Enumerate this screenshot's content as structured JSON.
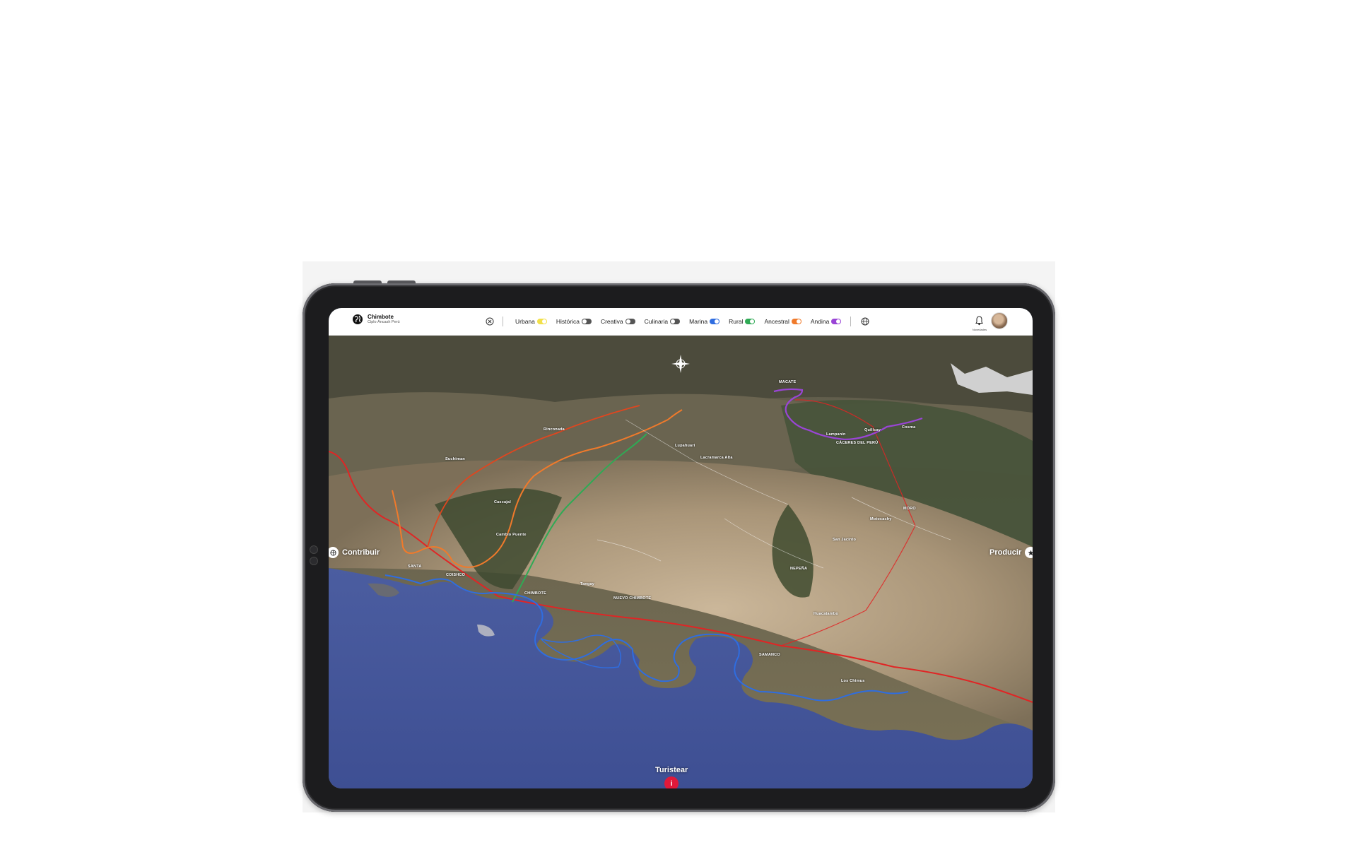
{
  "brand": {
    "name": "Chimbote",
    "subtitle": "Ciplo Áncash Perú"
  },
  "filters": [
    {
      "label": "Urbana",
      "color": "#f2e04a",
      "state": "on"
    },
    {
      "label": "Histórica",
      "color": "#555555",
      "state": "off"
    },
    {
      "label": "Creativa",
      "color": "#555555",
      "state": "off"
    },
    {
      "label": "Culinaria",
      "color": "#555555",
      "state": "off"
    },
    {
      "label": "Marina",
      "color": "#2f6de0",
      "state": "on"
    },
    {
      "label": "Rural",
      "color": "#2faa55",
      "state": "on"
    },
    {
      "label": "Ancestral",
      "color": "#f07a2b",
      "state": "on"
    },
    {
      "label": "Andina",
      "color": "#9a45d6",
      "state": "on"
    }
  ],
  "header": {
    "notifications_label": "Novedades"
  },
  "nav": {
    "left_label": "Contribuir",
    "right_label": "Producir",
    "bottom_label": "Turistear"
  },
  "places": {
    "macate": "MACATE",
    "lupahuari": "Lupahuari",
    "lacramarca": "Lacramarca Alta",
    "lampanin": "Lampanín",
    "quillcay": "Quillcay",
    "cosma": "Cosma",
    "caceres": "CÁCERES DEL PERÚ",
    "moro": "MORO",
    "motocachy": "Motocachy",
    "san_jacinto": "San Jacinto",
    "nepena": "NEPEÑA",
    "huacatambo": "Huacatambo",
    "samanco": "SAMANCO",
    "los_chimus": "Los Chimus",
    "santa": "SANTA",
    "coishco": "COISHCO",
    "chimbote": "CHIMBOTE",
    "nuevo_chimbote": "NUEVO CHIMBOTE",
    "tangay": "Tangay",
    "cascajal": "Cascajal",
    "cambio_puente": "Cambio Puente",
    "rinconada": "Rinconada",
    "suchiman": "Suchiman"
  },
  "icons": {
    "logo": "globe-logo-icon",
    "clear": "close-circle-icon",
    "language": "globe-icon",
    "notifications": "bell-icon",
    "compass": "compass-icon",
    "contribute": "globe-small-icon",
    "produce": "star-icon",
    "info": "info-icon"
  },
  "route_colors": {
    "urbana_road": "#e02525",
    "marina": "#2f6de0",
    "rural": "#2faa55",
    "ancestral": "#f07a2b",
    "andina": "#9a45d6"
  }
}
